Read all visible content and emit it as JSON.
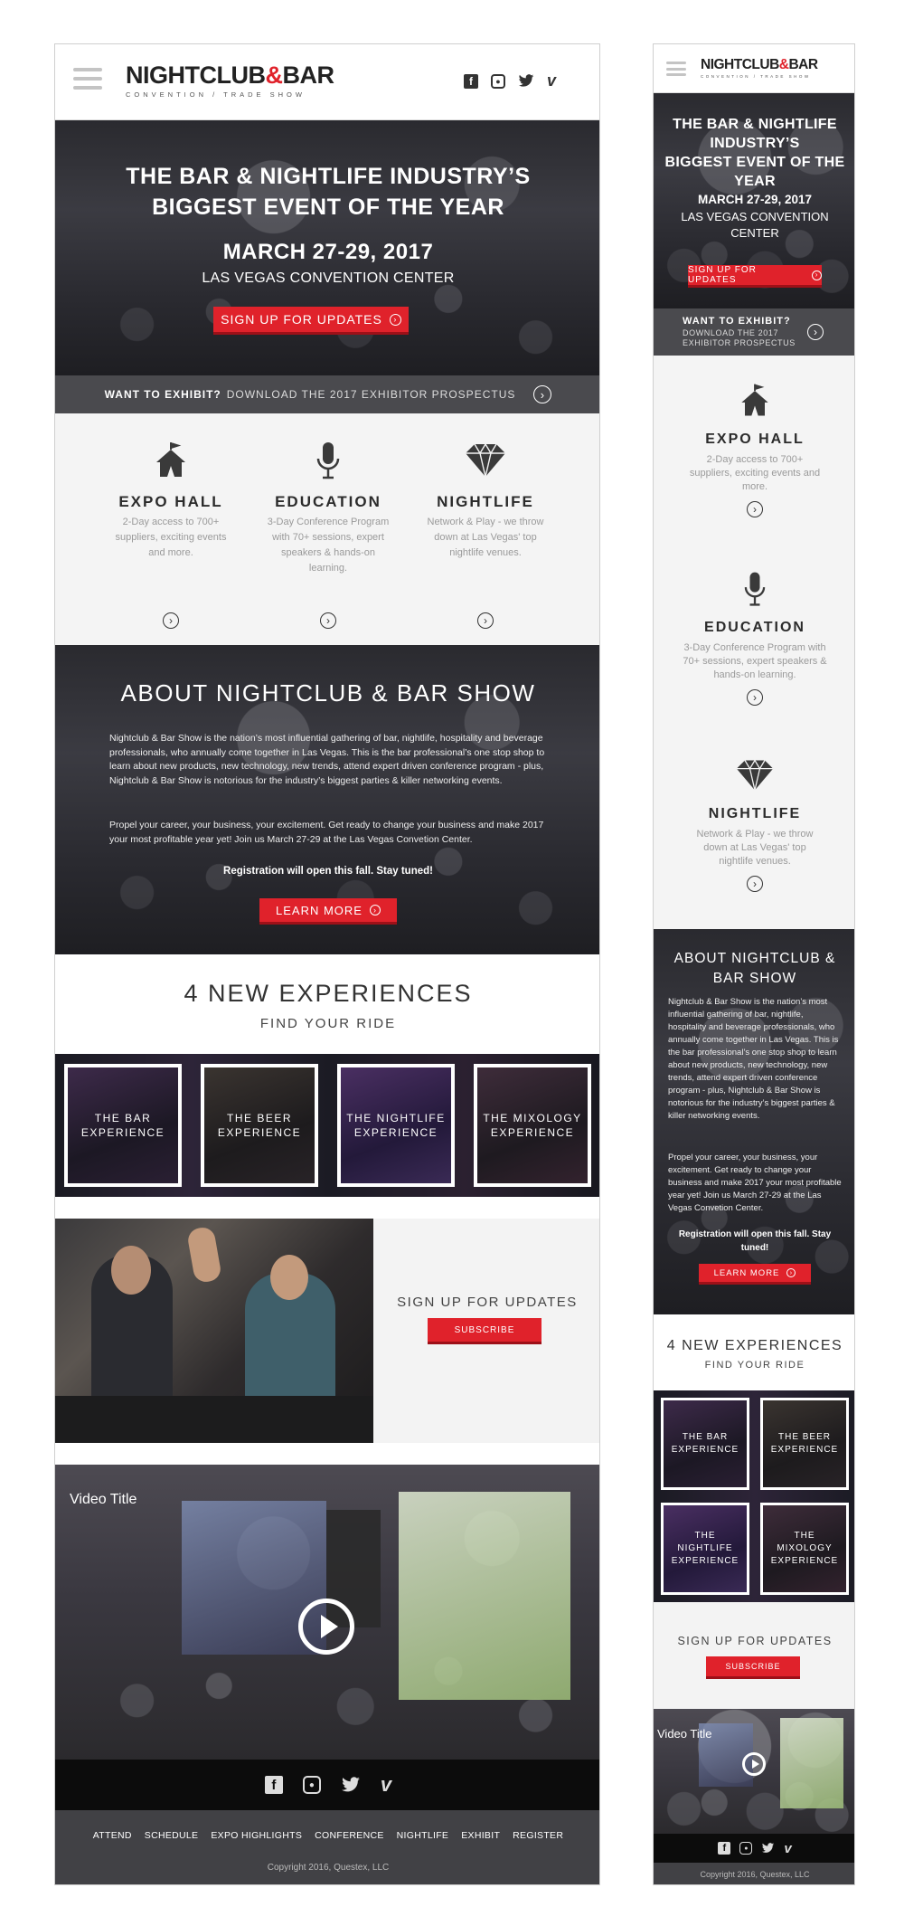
{
  "brand": {
    "name_part1": "NIGHTCLUB",
    "name_amp": "&",
    "name_part2": "BAR",
    "tagline": "CONVENTION / TRADE SHOW"
  },
  "social_icons": [
    "facebook-icon",
    "instagram-icon",
    "twitter-icon",
    "vimeo-icon"
  ],
  "social_glyphs": {
    "facebook": "f",
    "instagram": "◎",
    "twitter": "🐦",
    "vimeo": "v"
  },
  "colors": {
    "accent": "#e0222b",
    "dark": "#414145",
    "footer_black": "#0c0c0c"
  },
  "hero": {
    "title_line1": "THE BAR & NIGHTLIFE INDUSTRY’S",
    "title_line2": "BIGGEST EVENT OF THE YEAR",
    "date": "MARCH 27-29, 2017",
    "venue": "LAS VEGAS CONVENTION CENTER",
    "cta": "SIGN UP FOR UPDATES"
  },
  "exhibit": {
    "lead": "WANT TO EXHIBIT?",
    "text": "DOWNLOAD THE 2017 EXHIBITOR PROSPECTUS"
  },
  "features": [
    {
      "title": "EXPO HALL",
      "desc": "2-Day access to 700+ suppliers, exciting events and more."
    },
    {
      "title": "EDUCATION",
      "desc": "3-Day Conference Program with 70+ sessions, expert speakers & hands-on learning."
    },
    {
      "title": "NIGHTLIFE",
      "desc": "Network & Play - we throw down at Las Vegas' top nightlife venues."
    }
  ],
  "about": {
    "title": "ABOUT NIGHTCLUB & BAR SHOW",
    "paragraph1": "Nightclub & Bar Show is the nation’s most influential gathering of bar, nightlife, hospitality and beverage professionals, who annually come together in Las Vegas. This is the bar professional’s one stop shop to learn about new products, new technology, new trends, attend expert driven conference program - plus, Nightclub & Bar Show is notorious for the industry’s biggest parties & killer networking events.",
    "paragraph2": "Propel your career, your business, your excitement. Get ready to change your business and make 2017 your most profitable year yet! Join us March 27-29 at the Las Vegas Convetion Center.",
    "registration": "Registration will open this fall.   Stay tuned!",
    "cta": "LEARN MORE"
  },
  "experiences": {
    "title": "4 NEW EXPERIENCES",
    "subtitle": "FIND YOUR RIDE",
    "tiles": [
      "THE BAR EXPERIENCE",
      "THE BEER EXPERIENCE",
      "THE NIGHTLIFE EXPERIENCE",
      "THE MIXOLOGY EXPERIENCE"
    ]
  },
  "signup": {
    "title": "SIGN UP FOR UPDATES",
    "cta": "SUBSCRIBE"
  },
  "video": {
    "title": "Video Title"
  },
  "footer": {
    "links": [
      "ATTEND",
      "SCHEDULE",
      "EXPO HIGHLIGHTS",
      "CONFERENCE",
      "NIGHTLIFE",
      "EXHIBIT",
      "REGISTER"
    ],
    "copyright": "Copyright 2016, Questex, LLC"
  }
}
